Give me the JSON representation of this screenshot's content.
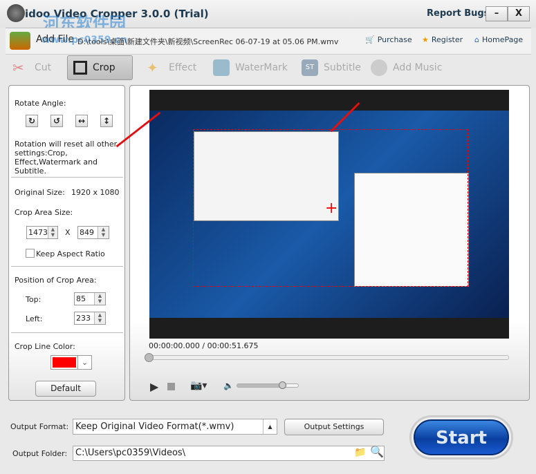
{
  "window": {
    "title": "idoo Video Cropper 3.0.0 (Trial)",
    "report_bugs": "Report Bugs",
    "minimize": "–",
    "close": "X"
  },
  "watermark": {
    "site_name": "河东软件园",
    "url": "www.pc0359.cn"
  },
  "file_bar": {
    "add_file": "Add File",
    "path": "D:\\tools\\桌面\\新建文件夹\\新视频\\ScreenRec 06-07-19 at 05.06 PM.wmv",
    "purchase": "Purchase",
    "register": "Register",
    "homepage": "HomePage"
  },
  "tabs": [
    {
      "label": "Cut",
      "active": false
    },
    {
      "label": "Crop",
      "active": true
    },
    {
      "label": "Effect",
      "active": false
    },
    {
      "label": "WaterMark",
      "active": false
    },
    {
      "label": "Subtitle",
      "active": false
    },
    {
      "label": "Add Music",
      "active": false
    }
  ],
  "crop_panel": {
    "rotate_label": "Rotate Angle:",
    "rotate_buttons": [
      "rotate-right",
      "rotate-left",
      "flip-horizontal",
      "flip-vertical"
    ],
    "rotation_note": "Rotation will reset all other settings:Crop, Effect,Watermark and Subtitle.",
    "original_size_label": "Original Size:",
    "original_size": "1920 x 1080",
    "crop_area_size_label": "Crop Area Size:",
    "width": "1473",
    "x_sep": "X",
    "height": "849",
    "keep_aspect": "Keep Aspect Ratio",
    "keep_aspect_checked": false,
    "position_label": "Position of Crop Area:",
    "top_label": "Top:",
    "top": "85",
    "left_label": "Left:",
    "left": "233",
    "line_color_label": "Crop Line Color:",
    "line_color": "#ff0000",
    "default_button": "Default"
  },
  "player": {
    "time": "00:00:00.000 / 00:00:51.675",
    "progress": 0,
    "volume": 0.75
  },
  "output": {
    "format_label": "Output Format:",
    "format_value": "Keep Original Video Format(*.wmv)",
    "settings_button": "Output Settings",
    "folder_label": "Output Folder:",
    "folder_value": "C:\\Users\\pc0359\\Videos\\",
    "start": "Start"
  }
}
